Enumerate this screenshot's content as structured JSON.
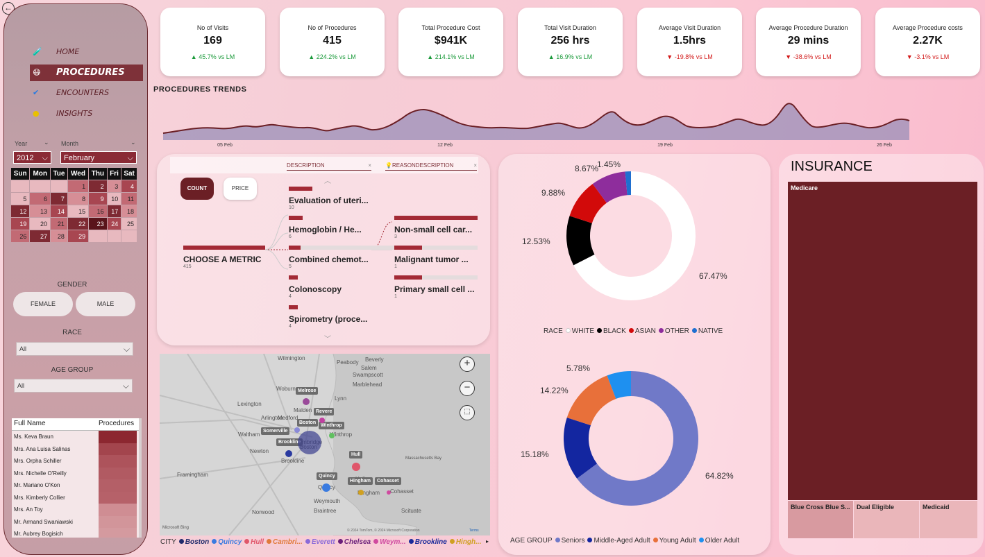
{
  "nav": {
    "items": [
      {
        "label": "HOME",
        "icon": "flask-icon"
      },
      {
        "label": "PROCEDURES",
        "icon": "face-icon",
        "active": true
      },
      {
        "label": "ENCOUNTERS",
        "icon": "check-icon"
      },
      {
        "label": "INSIGHTS",
        "icon": "bulb-icon"
      }
    ]
  },
  "filters": {
    "year_label": "Year",
    "year_value": "2012",
    "month_label": "Month",
    "month_value": "February",
    "gender_title": "GENDER",
    "gender_options": [
      "FEMALE",
      "MALE"
    ],
    "race_title": "RACE",
    "race_value": "All",
    "age_title": "AGE GROUP",
    "age_value": "All"
  },
  "calendar": {
    "days": [
      "Sun",
      "Mon",
      "Tue",
      "Wed",
      "Thu",
      "Fri",
      "Sat"
    ],
    "weeks": [
      [
        "",
        "",
        "",
        "1",
        "2",
        "3",
        "4"
      ],
      [
        "5",
        "6",
        "7",
        "8",
        "9",
        "10",
        "11"
      ],
      [
        "12",
        "13",
        "14",
        "15",
        "16",
        "17",
        "18"
      ],
      [
        "19",
        "20",
        "21",
        "22",
        "23",
        "24",
        "25"
      ],
      [
        "26",
        "27",
        "28",
        "29",
        "",
        "",
        ""
      ]
    ]
  },
  "patients": {
    "col_name": "Full Name",
    "col_proc": "Procedures",
    "rows": [
      {
        "name": "Ms. Keva Braun",
        "shade": "#8c2730"
      },
      {
        "name": "Mrs. Ana Luisa Salinas",
        "shade": "#a3454d"
      },
      {
        "name": "Mrs. Orpha Schiller",
        "shade": "#ad535b"
      },
      {
        "name": "Mrs. Nichelle O'Reilly",
        "shade": "#b15a62"
      },
      {
        "name": "Mr. Mariano O'Kon",
        "shade": "#b45f67"
      },
      {
        "name": "Mrs. Kimberly Collier",
        "shade": "#b66169"
      },
      {
        "name": "Mrs. An Toy",
        "shade": "#cf8d93"
      },
      {
        "name": "Mr. Armand Swaniawski",
        "shade": "#d2959a"
      },
      {
        "name": "Mr. Aubrey Bogisich",
        "shade": "#d49a9f"
      }
    ]
  },
  "kpis": [
    {
      "title": "No of Visits",
      "value": "169",
      "delta": "45.7% vs LM",
      "dir": "up"
    },
    {
      "title": "No of Procedures",
      "value": "415",
      "delta": "224.2% vs LM",
      "dir": "up"
    },
    {
      "title": "Total Procedure Cost",
      "value": "$941K",
      "delta": "214.1% vs LM",
      "dir": "up"
    },
    {
      "title": "Total Visit Duration",
      "value": "256 hrs",
      "delta": "16.9% vs LM",
      "dir": "up"
    },
    {
      "title": "Average Visit Duration",
      "value": "1.5hrs",
      "delta": "-19.8% vs LM",
      "dir": "down"
    },
    {
      "title": "Average Procedure Duration",
      "value": "29 mins",
      "delta": "-38.6% vs LM",
      "dir": "down"
    },
    {
      "title": "Average Procedure costs",
      "value": "2.27K",
      "delta": "-3.1% vs LM",
      "dir": "down"
    }
  ],
  "trend": {
    "title": "PROCEDURES TRENDS",
    "ticks": [
      "05 Feb",
      "12 Feb",
      "19 Feb",
      "26 Feb"
    ]
  },
  "tree": {
    "btn_count": "COUNT",
    "btn_price": "PRICE",
    "col1": "DESCRIPTION",
    "col2": "REASONDESCRIPTION",
    "root_label": "CHOOSE A METRIC",
    "root_value": "415",
    "level1": [
      {
        "label": "Evaluation of uteri...",
        "value": "10"
      },
      {
        "label": "Hemoglobin / He...",
        "value": "6"
      },
      {
        "label": "Combined chemot...",
        "value": "5"
      },
      {
        "label": "Colonoscopy",
        "value": "4"
      },
      {
        "label": "Spirometry (proce...",
        "value": "4"
      }
    ],
    "level2": [
      {
        "label": "Non-small cell car...",
        "value": "3"
      },
      {
        "label": "Malignant tumor ...",
        "value": "1"
      },
      {
        "label": "Primary small cell ...",
        "value": "1"
      }
    ]
  },
  "map": {
    "places": [
      "Wilmington",
      "Peabody",
      "Beverly",
      "Salem",
      "Marblehead",
      "Swampscott",
      "Lynn",
      "Woburn",
      "Malden",
      "Medford",
      "Arlington",
      "Lexington",
      "Waltham",
      "Cambridge",
      "Boston",
      "Newton",
      "Framingham",
      "Braintree",
      "Weymouth",
      "Norwood",
      "Scituate",
      "Massachusetts Bay",
      "Cohasset",
      "Hingham",
      "Quincy",
      "Hull",
      "Winthrop",
      "Brookline"
    ],
    "city_labels": [
      "Melrose",
      "Revere",
      "Boston",
      "Winthrop",
      "Somerville",
      "Brookline",
      "Hull",
      "Quincy",
      "Hingham",
      "Cohasset"
    ],
    "attribution": "© 2024 TomTom, © 2024 Microsoft Corporation",
    "terms": "Terms",
    "bing": "Microsoft Bing",
    "legend_title": "CITY",
    "legend": [
      {
        "name": "Boston",
        "color": "#1f2a6b"
      },
      {
        "name": "Quincy",
        "color": "#3a7be0"
      },
      {
        "name": "Hull",
        "color": "#e0566a"
      },
      {
        "name": "Cambri...",
        "color": "#e07a3a"
      },
      {
        "name": "Everett",
        "color": "#8a6ad8"
      },
      {
        "name": "Chelsea",
        "color": "#6a1f7a"
      },
      {
        "name": "Weym...",
        "color": "#d04aa0"
      },
      {
        "name": "Brookline",
        "color": "#1a2a9a"
      },
      {
        "name": "Hingh...",
        "color": "#d0a020"
      }
    ]
  },
  "race_chart": {
    "legend_title": "RACE",
    "segments": [
      {
        "name": "WHITE",
        "pct": 67.47,
        "label": "67.47%",
        "color": "#ffffff"
      },
      {
        "name": "BLACK",
        "pct": 12.53,
        "label": "12.53%",
        "color": "#000000"
      },
      {
        "name": "ASIAN",
        "pct": 9.88,
        "label": "9.88%",
        "color": "#d20a0a"
      },
      {
        "name": "OTHER",
        "pct": 8.67,
        "label": "8.67%",
        "color": "#8e2d9c"
      },
      {
        "name": "NATIVE",
        "pct": 1.45,
        "label": "1.45%",
        "color": "#1f6fd0"
      }
    ]
  },
  "age_chart": {
    "legend_title": "AGE GROUP",
    "segments": [
      {
        "name": "Seniors",
        "pct": 64.82,
        "label": "64.82%",
        "color": "#7079c8"
      },
      {
        "name": "Middle-Aged Adult",
        "pct": 15.18,
        "label": "15.18%",
        "color": "#1326a0"
      },
      {
        "name": "Young Adult",
        "pct": 14.22,
        "label": "14.22%",
        "color": "#e8703a"
      },
      {
        "name": "Older Adult",
        "pct": 5.78,
        "label": "5.78%",
        "color": "#1e90f0"
      }
    ]
  },
  "insurance": {
    "title": "INSURANCE",
    "tiles": [
      "Medicare",
      "Blue Cross Blue S...",
      "Dual Eligible",
      "Medicaid"
    ]
  }
}
